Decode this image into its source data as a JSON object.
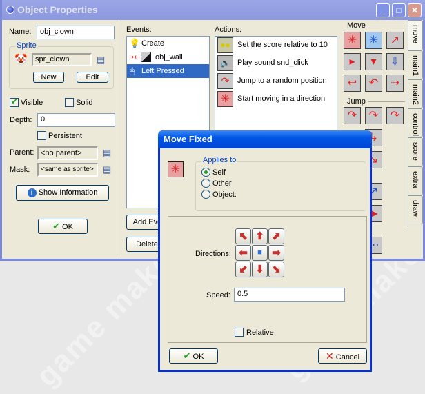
{
  "window": {
    "title": "Object Properties",
    "controls": {
      "minimize": "_",
      "maximize": "□",
      "close": "✕"
    }
  },
  "left": {
    "name_label": "Name:",
    "name_value": "obj_clown",
    "sprite_group": "Sprite",
    "sprite_value": "spr_clown",
    "new_label": "New",
    "edit_label": "Edit",
    "visible_label": "Visible",
    "visible_checked": true,
    "solid_label": "Solid",
    "solid_checked": false,
    "depth_label": "Depth:",
    "depth_value": "0",
    "persistent_label": "Persistent",
    "persistent_checked": false,
    "parent_label": "Parent:",
    "parent_value": "<no parent>",
    "mask_label": "Mask:",
    "mask_value": "<same as sprite>",
    "show_info_label": "Show Information",
    "ok_label": "OK"
  },
  "events": {
    "label": "Events:",
    "items": [
      {
        "label": "Create",
        "icon": "lightbulb-icon",
        "selected": false
      },
      {
        "label": "obj_wall",
        "icon": "collision-icon",
        "selected": false
      },
      {
        "label": "Left Pressed",
        "icon": "mouse-icon",
        "selected": true
      }
    ],
    "add_label": "Add Event",
    "delete_label": "Delete"
  },
  "actions": {
    "label": "Actions:",
    "items": [
      {
        "label": "Set the score relative to 10",
        "icon": "score-icon"
      },
      {
        "label": "Play sound snd_click",
        "icon": "speaker-icon"
      },
      {
        "label": "Jump to a random position",
        "icon": "jump-random-icon"
      },
      {
        "label": "Start moving in a direction",
        "icon": "move-fixed-icon"
      }
    ]
  },
  "palette": {
    "move_group": "Move",
    "jump_group": "Jump",
    "tabs": [
      "move",
      "main1",
      "main2",
      "control",
      "score",
      "extra",
      "draw"
    ],
    "active_tab": "move"
  },
  "dialog": {
    "title": "Move Fixed",
    "applies_to_label": "Applies to",
    "options": [
      {
        "label": "Self",
        "selected": true
      },
      {
        "label": "Other",
        "selected": false
      },
      {
        "label": "Object:",
        "selected": false
      }
    ],
    "directions_label": "Directions:",
    "speed_label": "Speed:",
    "speed_value": "0.5",
    "relative_label": "Relative",
    "relative_checked": false,
    "ok_label": "OK",
    "cancel_label": "Cancel"
  },
  "watermark": "game maker"
}
